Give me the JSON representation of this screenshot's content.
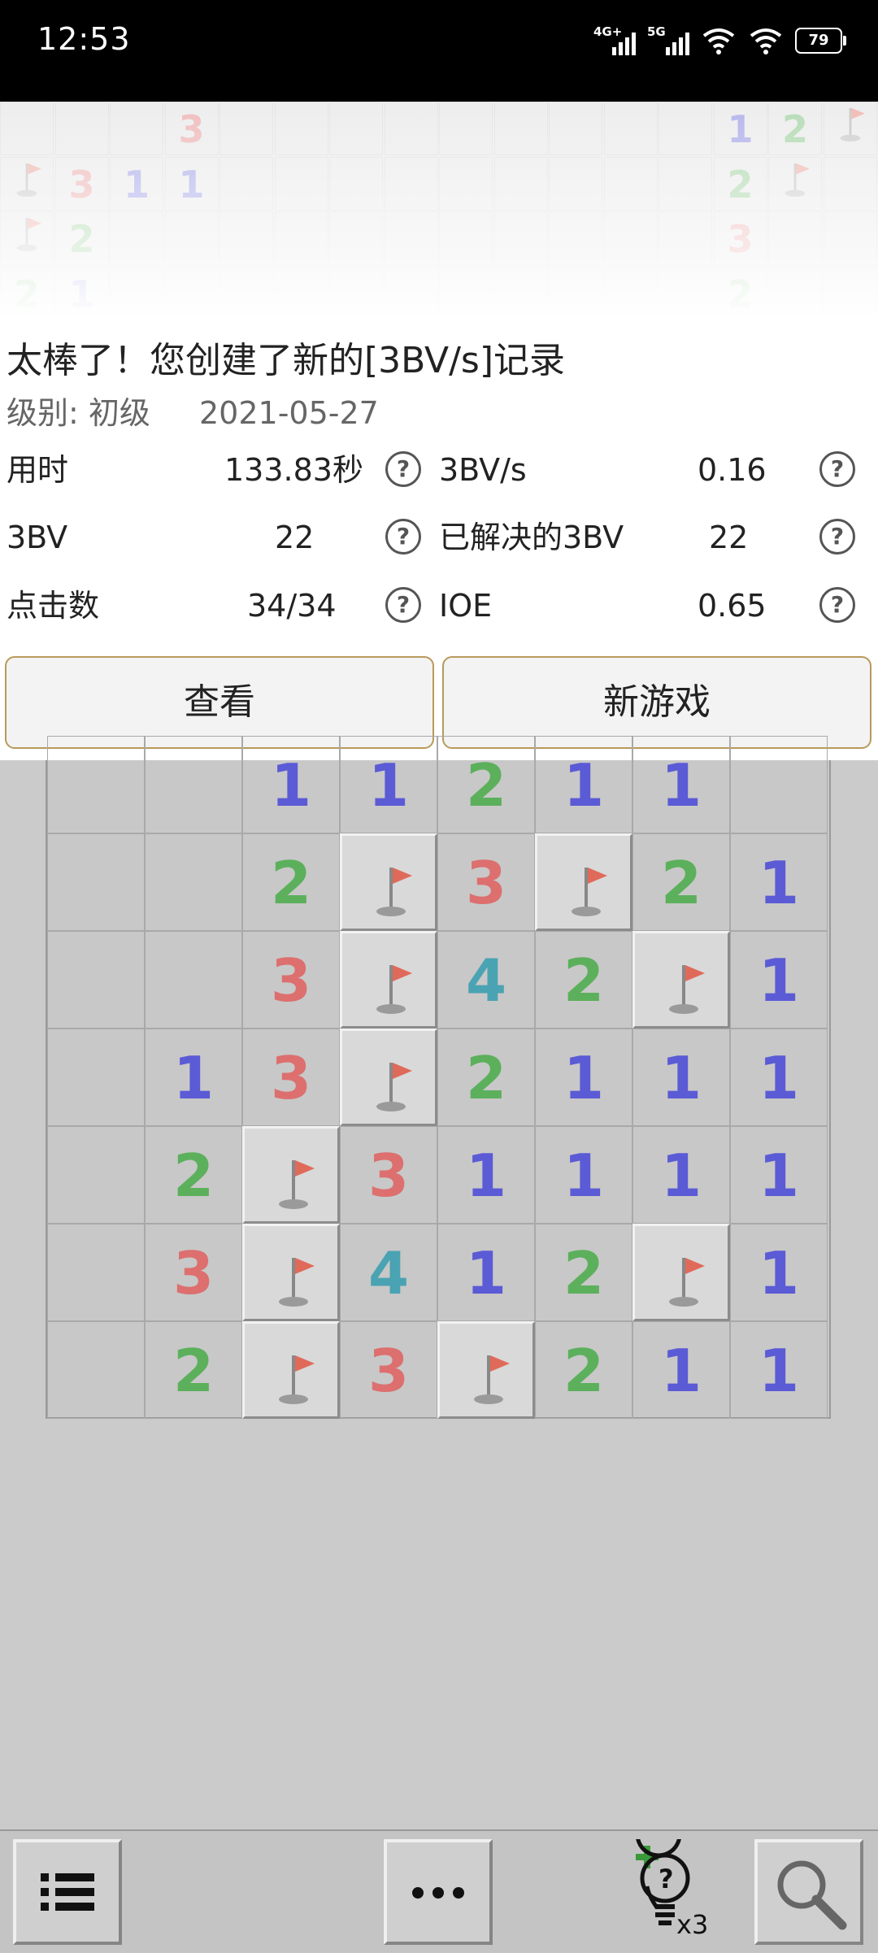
{
  "status_bar": {
    "time": "12:53",
    "net1": "4G+",
    "net2": "5G",
    "battery": "79"
  },
  "result": {
    "title": "太棒了！您创建了新的[3BV/s]记录",
    "level": "级别: 初级",
    "date": "2021-05-27",
    "stats": [
      {
        "label": "用时",
        "value": "133.83秒"
      },
      {
        "label": "3BV/s",
        "value": "0.16"
      },
      {
        "label": "3BV",
        "value": "22"
      },
      {
        "label": "已解决的3BV",
        "value": "22"
      },
      {
        "label": "点击数",
        "value": "34/34"
      },
      {
        "label": "IOE",
        "value": "0.65"
      }
    ],
    "help_symbol": "?",
    "view_button": "查看",
    "new_game_button": "新游戏"
  },
  "top_strip": [
    [
      "",
      "",
      "",
      "3",
      "",
      "",
      "",
      "",
      "",
      "",
      "",
      "",
      "",
      "1",
      "2",
      "F"
    ],
    [
      "F",
      "3",
      "1",
      "1",
      "",
      "",
      "",
      "",
      "",
      "",
      "",
      "",
      "",
      "2",
      "F",
      ""
    ],
    [
      "F",
      "2",
      "",
      "",
      "",
      "",
      "",
      "",
      "",
      "",
      "",
      "",
      "",
      "3",
      "",
      ""
    ],
    [
      "2",
      "1",
      "",
      "",
      "",
      "",
      "",
      "",
      "",
      "",
      "",
      "",
      "",
      "2",
      "",
      ""
    ]
  ],
  "board": [
    [
      "",
      "",
      "1",
      "1",
      "2",
      "1",
      "1",
      ""
    ],
    [
      "",
      "",
      "2",
      "F",
      "3",
      "F",
      "2",
      "1"
    ],
    [
      "",
      "",
      "3",
      "F",
      "4",
      "2",
      "F",
      "1"
    ],
    [
      "",
      "1",
      "3",
      "F",
      "2",
      "1",
      "1",
      "1"
    ],
    [
      "",
      "2",
      "F",
      "3",
      "1",
      "1",
      "1",
      "1"
    ],
    [
      "",
      "3",
      "F",
      "4",
      "1",
      "2",
      "F",
      "1"
    ],
    [
      "",
      "2",
      "F",
      "3",
      "F",
      "2",
      "1",
      "1"
    ]
  ],
  "colors": {
    "n1": "#5b5bd6",
    "n2": "#5cb05c",
    "n3": "#dd6f6f",
    "n4": "#4aa3b2",
    "flag": "#e06a5a"
  },
  "toolbar": {
    "hint_count": "x3",
    "icons": [
      "menu-list-icon",
      "more-dots-icon",
      "hint-bulb-icon",
      "search-zoom-icon"
    ]
  }
}
